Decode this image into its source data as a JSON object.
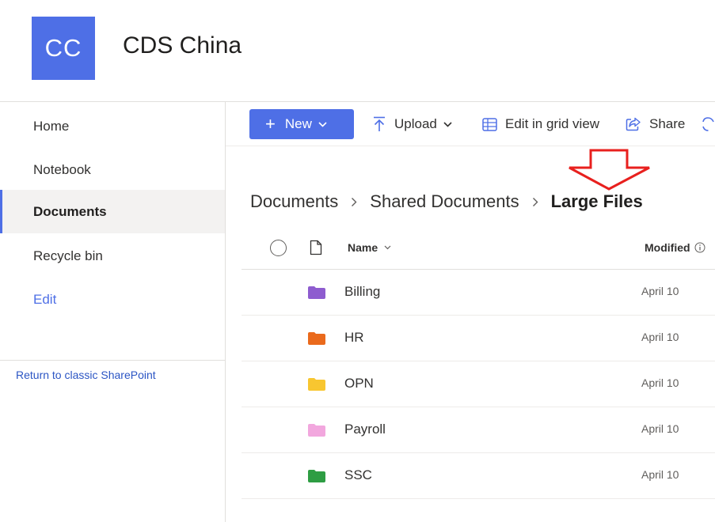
{
  "site": {
    "logo_text": "CC",
    "title": "CDS China",
    "accent_color": "#4e6fe6"
  },
  "nav": {
    "items": [
      {
        "label": "Home",
        "selected": false
      },
      {
        "label": "Notebook",
        "selected": false
      },
      {
        "label": "Documents",
        "selected": true
      },
      {
        "label": "Recycle bin",
        "selected": false
      }
    ],
    "edit_label": "Edit",
    "classic_link": "Return to classic SharePoint"
  },
  "commands": {
    "new_label": "New",
    "upload_label": "Upload",
    "grid_label": "Edit in grid view",
    "share_label": "Share"
  },
  "breadcrumb": [
    "Documents",
    "Shared Documents",
    "Large Files"
  ],
  "list": {
    "columns": {
      "name": "Name",
      "modified": "Modified"
    },
    "rows": [
      {
        "name": "Billing",
        "modified": "April 10",
        "folder_color": "#8e5ccf"
      },
      {
        "name": "HR",
        "modified": "April 10",
        "folder_color": "#ea6a1c"
      },
      {
        "name": "OPN",
        "modified": "April 10",
        "folder_color": "#f8c630"
      },
      {
        "name": "Payroll",
        "modified": "April 10",
        "folder_color": "#f2a7de"
      },
      {
        "name": "SSC",
        "modified": "April 10",
        "folder_color": "#2e9d43"
      }
    ]
  },
  "annotation": {
    "arrow_color": "#e8201e",
    "icon": "down-arrow-outline-icon"
  }
}
